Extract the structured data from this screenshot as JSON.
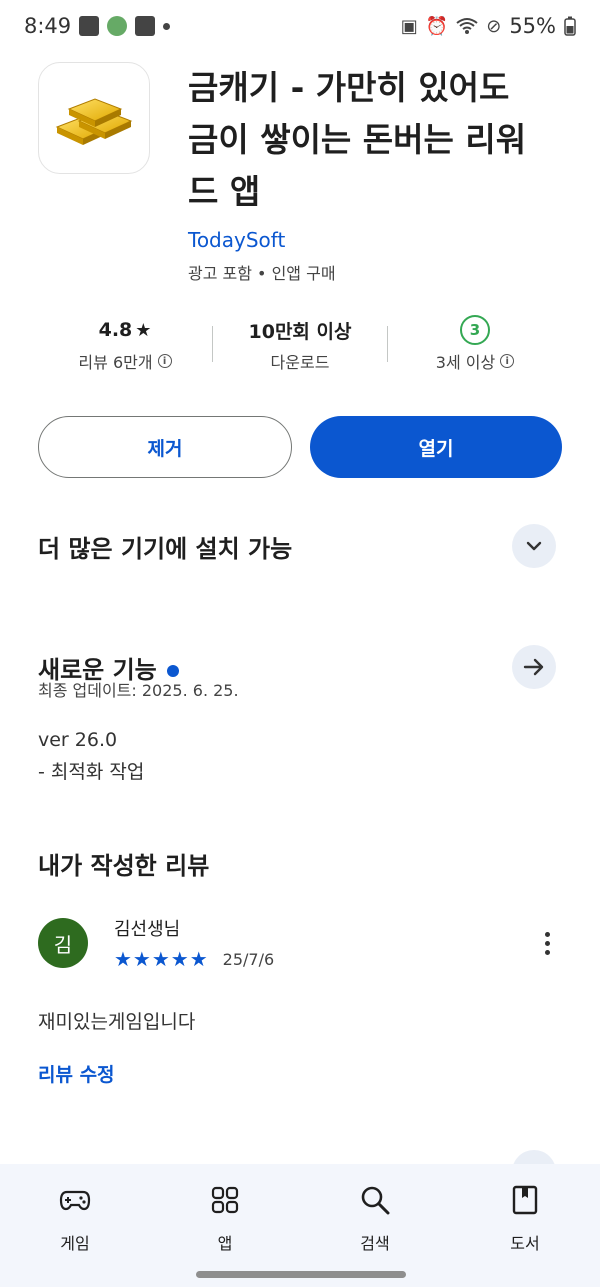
{
  "status_bar": {
    "time": "8:49",
    "battery": "55%"
  },
  "app": {
    "title": "금캐기 - 가만히 있어도 금이 쌓이는 돈버는 리워드 앱",
    "developer": "TodaySoft",
    "notes": "광고 포함 • 인앱 구매",
    "icon": "gold-bars-icon"
  },
  "stats": {
    "rating": "4.8",
    "rating_label": "리뷰 6만개",
    "downloads": "10만회 이상",
    "downloads_label": "다운로드",
    "age_badge": "3",
    "age_label": "3세 이상"
  },
  "actions": {
    "uninstall": "제거",
    "open": "열기"
  },
  "devices": {
    "title": "더 많은 기기에 설치 가능"
  },
  "whats_new": {
    "title": "새로운 기능",
    "updated": "최종 업데이트: 2025. 6. 25.",
    "version": "ver 26.0",
    "notes": "- 최적화 작업"
  },
  "my_review": {
    "title": "내가 작성한 리뷰",
    "avatar_letter": "김",
    "reviewer": "김선생님",
    "stars": "★★★★★",
    "rating": 5,
    "date": "25/7/6",
    "text": "재미있는게임입니다",
    "edit": "리뷰 수정"
  },
  "bottom_nav": [
    {
      "label": "게임",
      "icon": "gamepad-icon"
    },
    {
      "label": "앱",
      "icon": "apps-grid-icon"
    },
    {
      "label": "검색",
      "icon": "search-icon"
    },
    {
      "label": "도서",
      "icon": "book-icon"
    }
  ],
  "colors": {
    "accent": "#0b57d0",
    "avatar": "#2e6b1f",
    "age_badge": "#34a853",
    "nav_bg": "#f3f6fc"
  }
}
